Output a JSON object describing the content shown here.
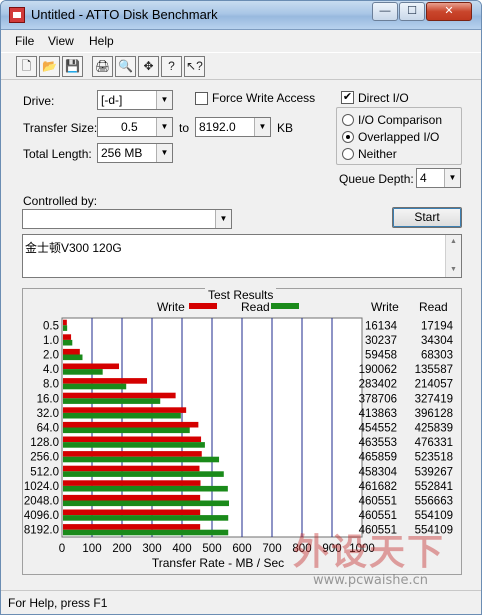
{
  "window": {
    "title": "Untitled - ATTO Disk Benchmark",
    "min_glyph": "—",
    "max_glyph": "☐",
    "close_glyph": "✕"
  },
  "menu": [
    "File",
    "View",
    "Help"
  ],
  "toolbar": [
    "new-icon",
    "open-icon",
    "save-icon",
    "print-icon",
    "print-preview-icon",
    "move-icon",
    "help-icon",
    "context-help-icon"
  ],
  "toolbar_glyphs": [
    "🗋",
    "📂",
    "💾",
    "🖨",
    "🔍",
    "✥",
    "?",
    "↖?"
  ],
  "form": {
    "drive_label": "Drive:",
    "drive_value": "[-d-]",
    "transfer_size_label": "Transfer Size:",
    "transfer_from": "0.5",
    "to_label": "to",
    "transfer_to": "8192.0",
    "kb_label": "KB",
    "total_length_label": "Total Length:",
    "total_length_value": "256 MB",
    "force_write_label": "Force Write Access",
    "force_write_checked": false,
    "direct_io_label": "Direct I/O",
    "direct_io_checked": true,
    "direct_io_check_glyph": "✔",
    "io_comparison_label": "I/O Comparison",
    "overlapped_io_label": "Overlapped I/O",
    "neither_label": "Neither",
    "io_mode_selected": "overlapped",
    "queue_depth_label": "Queue Depth:",
    "queue_depth_value": "4",
    "controlled_by_label": "Controlled by:",
    "controlled_by_value": "",
    "start_label": "Start",
    "dropdown_glyph": "▼",
    "description": "金士顿V300 120G"
  },
  "results": {
    "title": "Test Results",
    "write_legend": "Write",
    "read_legend": "Read",
    "write_col_header": "Write",
    "read_col_header": "Read"
  },
  "chart_data": {
    "type": "bar",
    "orientation": "horizontal",
    "categories": [
      "0.5",
      "1.0",
      "2.0",
      "4.0",
      "8.0",
      "16.0",
      "32.0",
      "64.0",
      "128.0",
      "256.0",
      "512.0",
      "1024.0",
      "2048.0",
      "4096.0",
      "8192.0"
    ],
    "series": [
      {
        "name": "Write",
        "color": "#d40000",
        "values": [
          16134,
          30237,
          59458,
          190062,
          283402,
          378706,
          413863,
          454552,
          463553,
          465859,
          458304,
          461682,
          460551,
          460551,
          460551
        ]
      },
      {
        "name": "Read",
        "color": "#1a8a1a",
        "values": [
          17194,
          34304,
          68303,
          135587,
          214057,
          327419,
          396128,
          425839,
          476331,
          523518,
          539267,
          552841,
          556663,
          554109,
          554109
        ]
      }
    ],
    "xlabel": "Transfer Rate - MB / Sec",
    "xlim": [
      0,
      1000
    ],
    "xticks": [
      0,
      100,
      200,
      300,
      400,
      500,
      600,
      700,
      800,
      900,
      1000
    ],
    "grid": true
  },
  "status": {
    "text": "For Help, press F1"
  },
  "watermark": {
    "text": "外设天下",
    "url": "www.pcwaishe.cn"
  }
}
